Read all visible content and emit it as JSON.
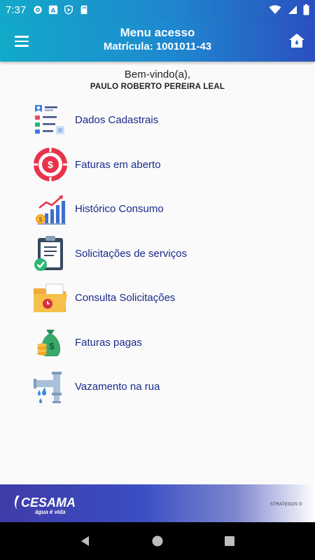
{
  "status_bar": {
    "time": "7:37",
    "left_icons": [
      "gear-icon",
      "a-icon",
      "play-shield-icon",
      "sd-card-icon"
    ],
    "right_icons": [
      "wifi-icon",
      "signal-icon",
      "battery-icon"
    ]
  },
  "app_bar": {
    "title": "Menu acesso",
    "subtitle": "Matrícula: 1001011-43",
    "menu_icon": "hamburger-icon",
    "home_icon": "home-icon"
  },
  "welcome": {
    "greeting": "Bem-vindo(a),",
    "name": "PAULO ROBERTO PEREIRA LEAL"
  },
  "menu": {
    "items": [
      {
        "label": "Dados Cadastrais",
        "icon": "profile-list-icon"
      },
      {
        "label": "Faturas em aberto",
        "icon": "dollar-target-icon"
      },
      {
        "label": "Histórico Consumo",
        "icon": "growth-chart-icon"
      },
      {
        "label": "Solicitações de serviços",
        "icon": "clipboard-check-icon"
      },
      {
        "label": "Consulta Solicitações",
        "icon": "folder-clock-icon"
      },
      {
        "label": "Faturas pagas",
        "icon": "money-bag-icon"
      },
      {
        "label": "Vazamento na rua",
        "icon": "leaking-pipe-icon"
      }
    ]
  },
  "footer": {
    "logo_text": "CESAMA",
    "logo_tagline": "água é vida",
    "credit": "STRATEGOS ©"
  },
  "nav_bar": {
    "buttons": [
      "back-icon",
      "home-circle-icon",
      "recents-icon"
    ]
  },
  "colors": {
    "accent_start": "#12aac9",
    "accent_end": "#2b4fbf",
    "menu_text": "#1a2a8c"
  }
}
